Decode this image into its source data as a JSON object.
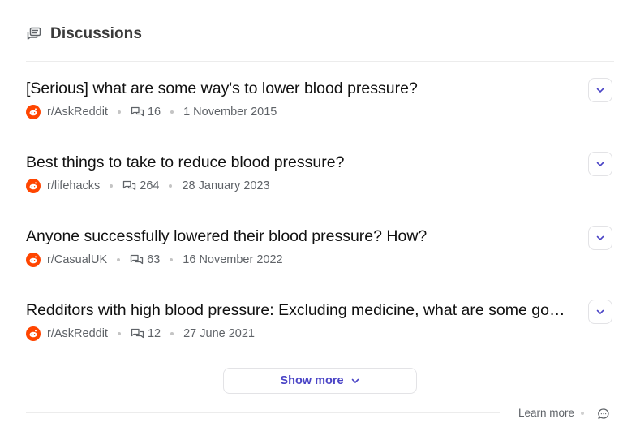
{
  "header": {
    "title": "Discussions",
    "icon": "discussions-icon"
  },
  "items": [
    {
      "title": "[Serious] what are some way's to lower blood pressure?",
      "subreddit": "r/AskReddit",
      "comments": "16",
      "date": "1 November 2015"
    },
    {
      "title": "Best things to take to reduce blood pressure?",
      "subreddit": "r/lifehacks",
      "comments": "264",
      "date": "28 January 2023"
    },
    {
      "title": "Anyone successfully lowered their blood pressure? How?",
      "subreddit": "r/CasualUK",
      "comments": "63",
      "date": "16 November 2022"
    },
    {
      "title": "Redditors with high blood pressure: Excluding medicine, what are some good ways to lower it?",
      "subreddit": "r/AskReddit",
      "comments": "12",
      "date": "27 June 2021"
    }
  ],
  "show_more_label": "Show more",
  "footer": {
    "learn_more": "Learn more"
  },
  "colors": {
    "accent": "#4a44c6",
    "reddit": "#ff4500"
  }
}
